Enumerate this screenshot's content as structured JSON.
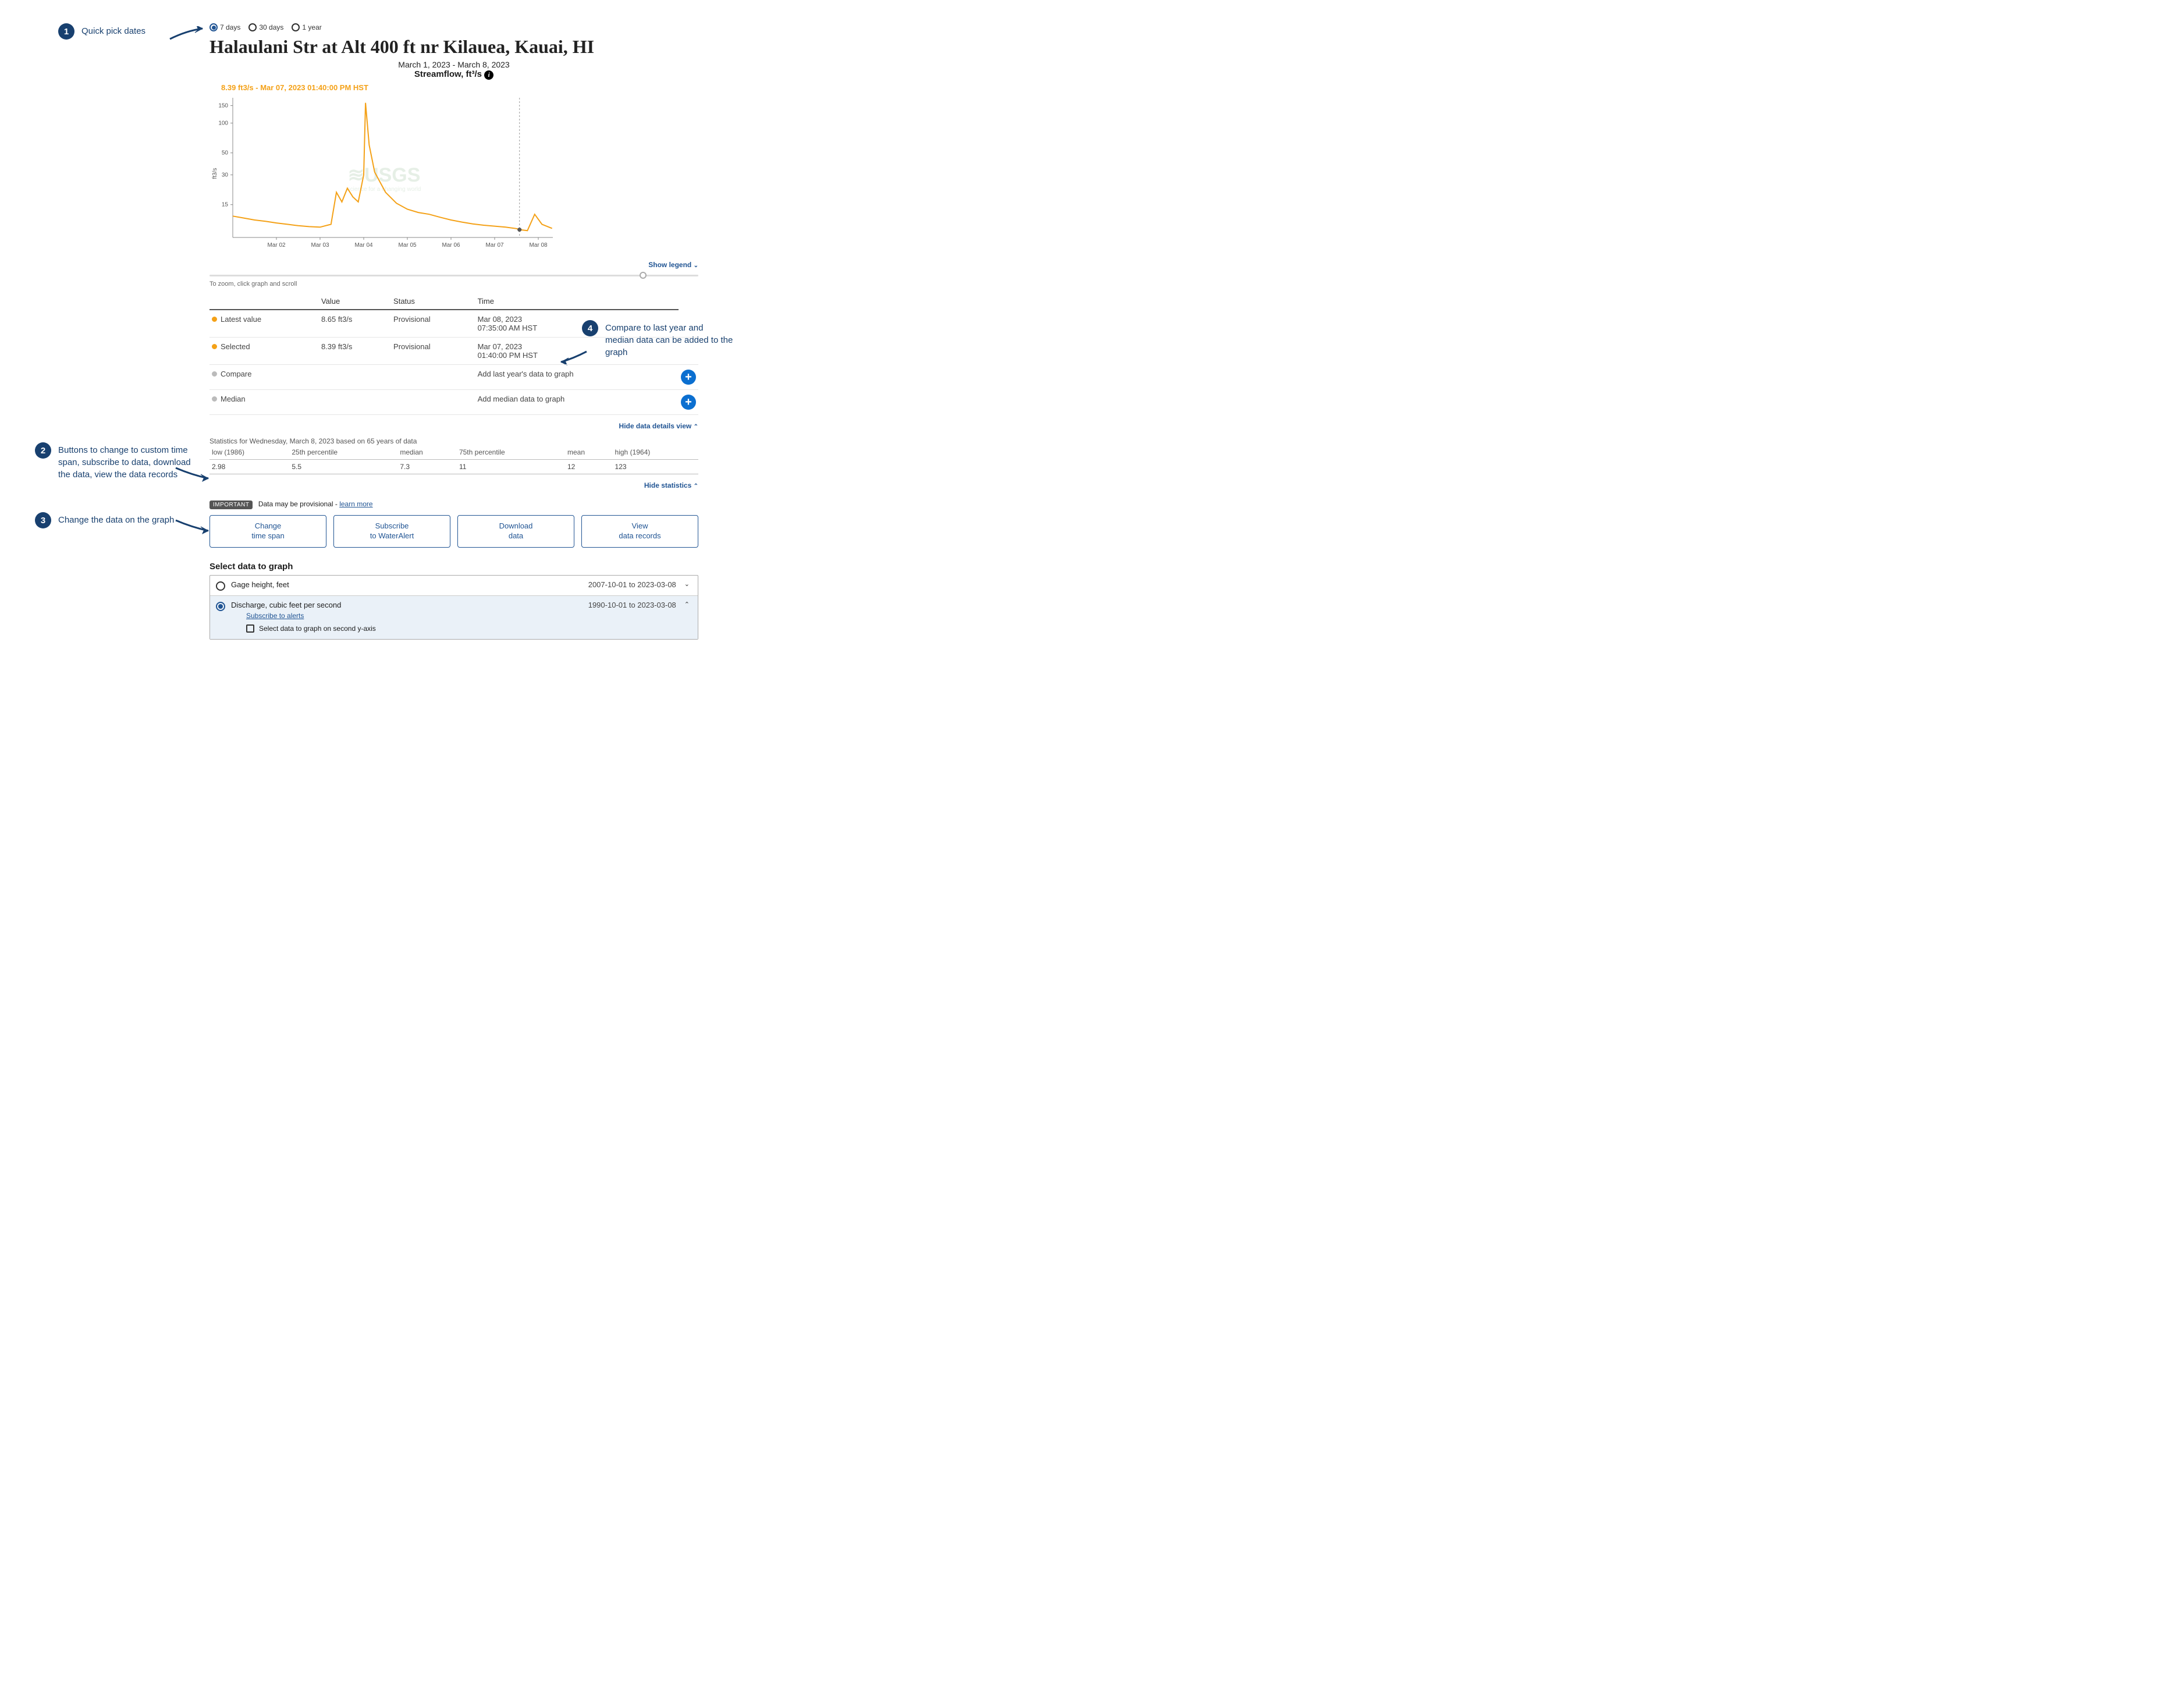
{
  "quick_picks": {
    "options": [
      "7 days",
      "30 days",
      "1 year"
    ],
    "selected_index": 0
  },
  "site_title": "Halaulani Str at Alt 400 ft nr Kilauea, Kauai, HI",
  "date_range": "March 1, 2023 - March 8, 2023",
  "param_title": "Streamflow, ft³/s",
  "streamflow_unit_sup": "3",
  "hover_label": "8.39 ft3/s - Mar 07, 2023 01:40:00 PM HST",
  "show_legend": "Show legend",
  "zoom_hint": "To zoom, click graph and scroll",
  "table": {
    "headers": [
      "",
      "Value",
      "Status",
      "Time"
    ],
    "rows": [
      {
        "bullet": "orange",
        "label": "Latest value",
        "value": "8.65 ft3/s",
        "status": "Provisional",
        "time": "Mar 08, 2023\n07:35:00 AM HST"
      },
      {
        "bullet": "orange",
        "label": "Selected",
        "value": "8.39 ft3/s",
        "status": "Provisional",
        "time": "Mar 07, 2023\n01:40:00 PM HST"
      },
      {
        "bullet": "gray",
        "label": "Compare",
        "value": "",
        "status": "",
        "time": "Add last year's data to graph",
        "add": true
      },
      {
        "bullet": "gray",
        "label": "Median",
        "value": "",
        "status": "",
        "time": "Add median data to graph",
        "add": true
      }
    ]
  },
  "hide_details": "Hide data details view",
  "stats_caption": "Statistics for Wednesday, March 8, 2023 based on 65 years of data",
  "stats": {
    "headers": [
      "low (1986)",
      "25th percentile",
      "median",
      "75th percentile",
      "mean",
      "high (1964)"
    ],
    "values": [
      "2.98",
      "5.5",
      "7.3",
      "11",
      "12",
      "123"
    ]
  },
  "hide_stats": "Hide statistics",
  "important_label": "IMPORTANT",
  "important_text": "Data may be provisional - ",
  "learn_more": "learn more",
  "actions": [
    {
      "l1": "Change",
      "l2": "time span"
    },
    {
      "l1": "Subscribe",
      "l2": "to WaterAlert"
    },
    {
      "l1": "Download",
      "l2": "data"
    },
    {
      "l1": "View",
      "l2": "data records"
    }
  ],
  "select_header": "Select data to graph",
  "params": [
    {
      "name": "Gage height, feet",
      "range": "2007-10-01 to 2023-03-08",
      "open": false,
      "selected": false
    },
    {
      "name": "Discharge, cubic feet per second",
      "range": "1990-10-01 to 2023-03-08",
      "open": true,
      "selected": true,
      "sublink": "Subscribe to alerts",
      "sub_checkbox": "Select data to graph on second y-axis"
    }
  ],
  "annotations": {
    "a1": "Quick pick dates",
    "a2": "Buttons to change to custom time span, subscribe to data, download the data, view the data records",
    "a3": "Change the data on the graph",
    "a4": "Compare to last year and median data can be added to the graph"
  },
  "chart_data": {
    "type": "line",
    "title": "Streamflow, ft³/s",
    "xlabel": "",
    "ylabel": "ft3/s",
    "x_ticks": [
      "Mar 02",
      "Mar 03",
      "Mar 04",
      "Mar 05",
      "Mar 06",
      "Mar 07",
      "Mar 08"
    ],
    "y_ticks": [
      15,
      30,
      50,
      100,
      150
    ],
    "x_range": [
      "2023-03-01T00:00",
      "2023-03-08T08:00"
    ],
    "ylim": [
      7,
      180
    ],
    "y_scale": "log",
    "hover_point": {
      "x": "2023-03-07T13:40",
      "y": 8.39
    },
    "series": [
      {
        "name": "Streamflow",
        "color": "#f4a117",
        "x": [
          "2023-03-01T00:00",
          "2023-03-01T06:00",
          "2023-03-01T12:00",
          "2023-03-01T18:00",
          "2023-03-02T00:00",
          "2023-03-02T06:00",
          "2023-03-02T12:00",
          "2023-03-02T18:00",
          "2023-03-03T00:00",
          "2023-03-03T06:00",
          "2023-03-03T09:00",
          "2023-03-03T12:00",
          "2023-03-03T15:00",
          "2023-03-03T18:00",
          "2023-03-03T21:00",
          "2023-03-04T00:00",
          "2023-03-04T01:00",
          "2023-03-04T03:00",
          "2023-03-04T06:00",
          "2023-03-04T12:00",
          "2023-03-04T18:00",
          "2023-03-05T00:00",
          "2023-03-05T06:00",
          "2023-03-05T12:00",
          "2023-03-05T18:00",
          "2023-03-06T00:00",
          "2023-03-06T06:00",
          "2023-03-06T12:00",
          "2023-03-06T18:00",
          "2023-03-07T00:00",
          "2023-03-07T06:00",
          "2023-03-07T12:00",
          "2023-03-07T13:40",
          "2023-03-07T18:00",
          "2023-03-07T22:00",
          "2023-03-08T02:00",
          "2023-03-08T07:35"
        ],
        "values": [
          11.5,
          11.0,
          10.5,
          10.2,
          9.8,
          9.5,
          9.2,
          9.0,
          8.9,
          9.5,
          20.0,
          16.0,
          22.0,
          18.0,
          16.0,
          30.0,
          160.0,
          60.0,
          32.0,
          20.0,
          15.5,
          13.5,
          12.5,
          12.0,
          11.2,
          10.5,
          10.0,
          9.6,
          9.3,
          9.1,
          8.9,
          8.6,
          8.39,
          8.2,
          12.0,
          9.5,
          8.65
        ]
      }
    ]
  }
}
